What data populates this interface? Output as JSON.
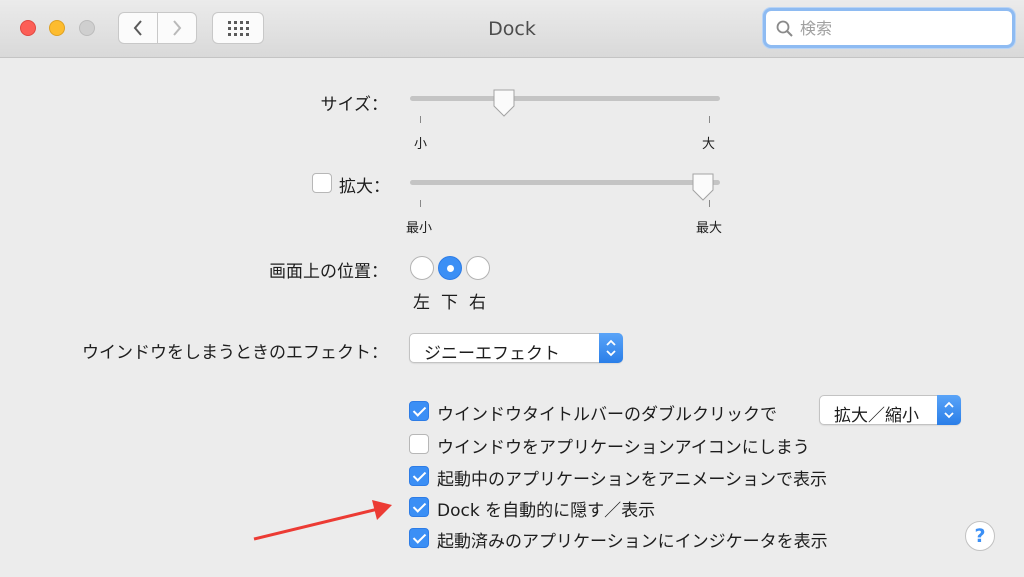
{
  "window": {
    "title": "Dock"
  },
  "search": {
    "placeholder": "検索"
  },
  "size": {
    "label": "サイズ：",
    "min_label": "小",
    "max_label": "大",
    "value": 0.28
  },
  "magnification": {
    "label": "拡大：",
    "checked": false,
    "min_label": "最小",
    "max_label": "最大",
    "value": 1.0
  },
  "position": {
    "label": "画面上の位置：",
    "options": [
      {
        "label": "左",
        "selected": false
      },
      {
        "label": "下",
        "selected": true
      },
      {
        "label": "右",
        "selected": false
      }
    ]
  },
  "minimize_effect": {
    "label": "ウインドウをしまうときのエフェクト：",
    "value": "ジニーエフェクト"
  },
  "options": [
    {
      "label": "ウインドウタイトルバーのダブルクリックで",
      "checked": true
    },
    {
      "label": "ウインドウをアプリケーションアイコンにしまう",
      "checked": false
    },
    {
      "label": "起動中のアプリケーションをアニメーションで表示",
      "checked": true
    },
    {
      "label": "Dock を自動的に隠す／表示",
      "checked": true
    },
    {
      "label": "起動済みのアプリケーションにインジケータを表示",
      "checked": true
    }
  ],
  "double_click_action": {
    "value": "拡大／縮小"
  },
  "help": {
    "label": "?"
  },
  "colors": {
    "accent": "#3b8ff5",
    "annotation_arrow": "#ec3b34"
  }
}
